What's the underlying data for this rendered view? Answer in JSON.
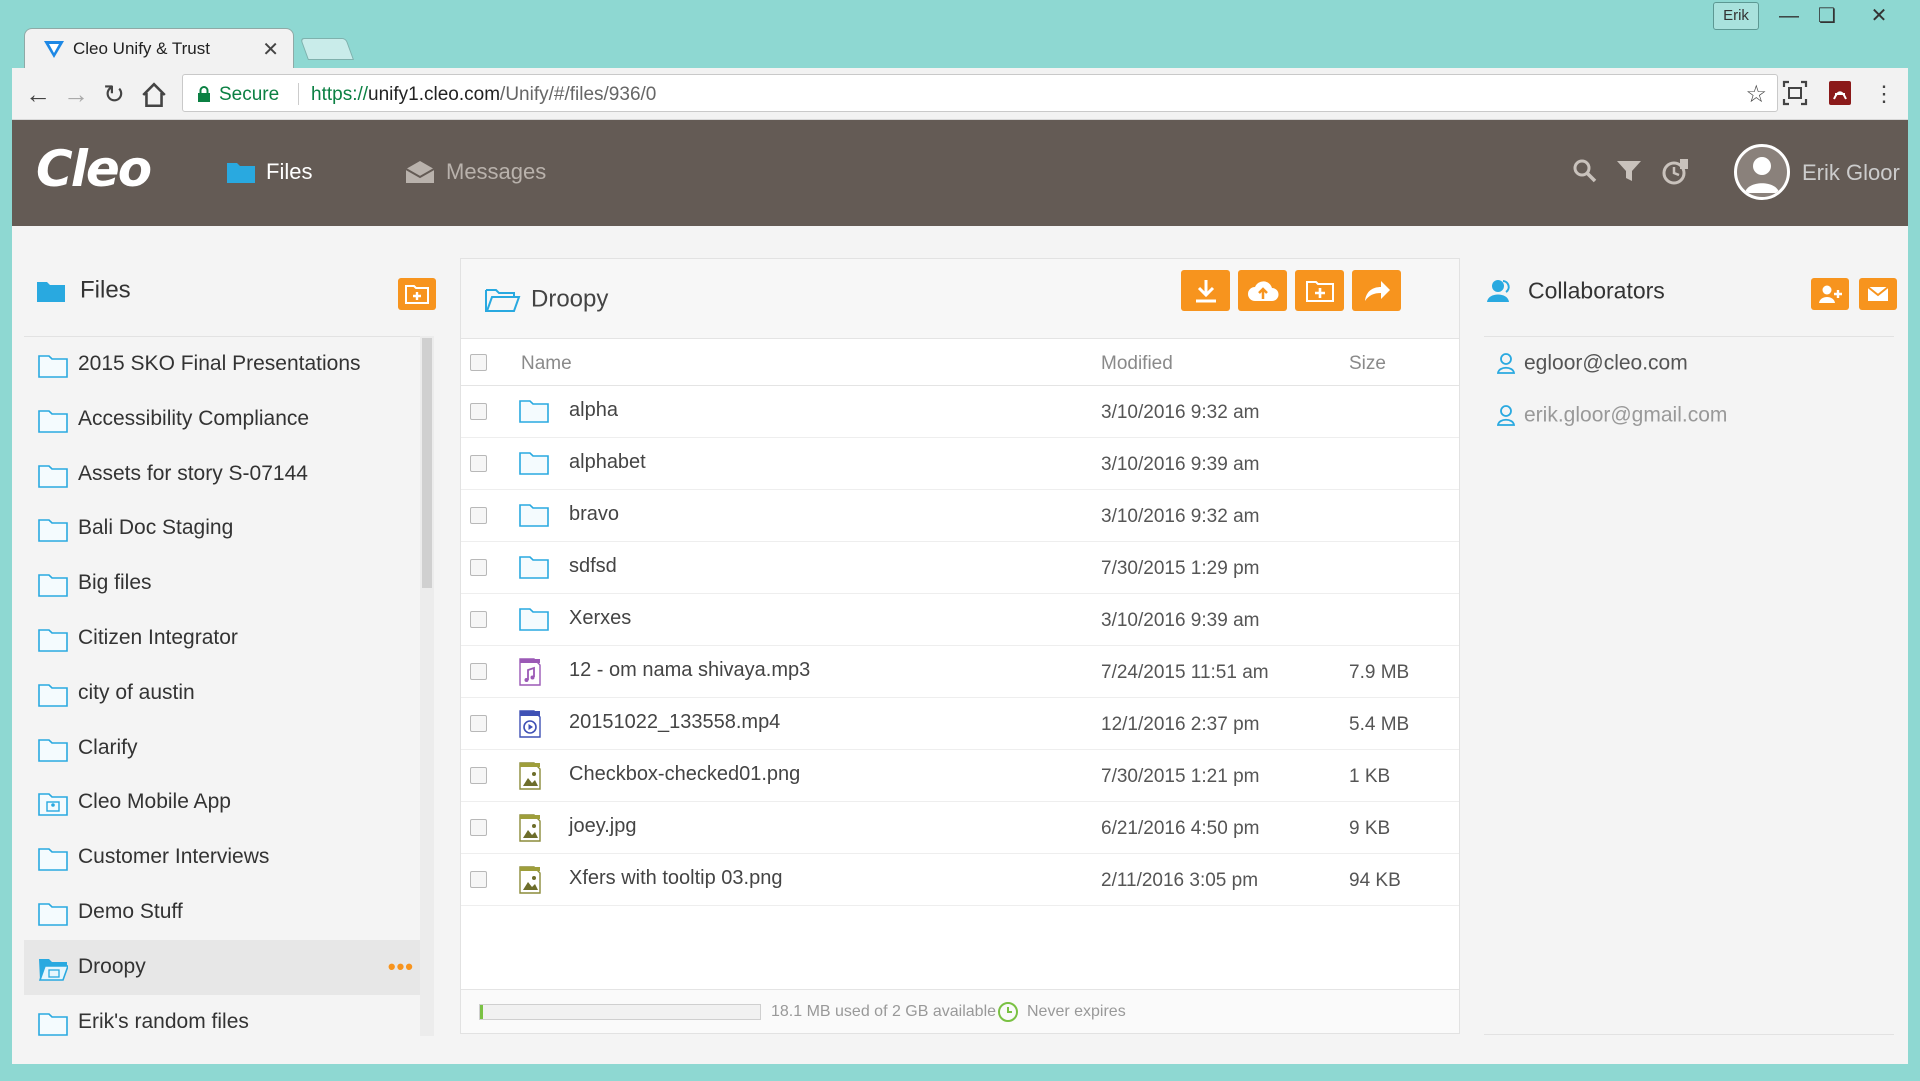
{
  "browser": {
    "profile_label": "Erik",
    "tab_title": "Cleo Unify & Trust",
    "secure_label": "Secure",
    "url_scheme": "https://",
    "url_host": "unify1.cleo.com",
    "url_path": "/Unify/#/files/936/0"
  },
  "header": {
    "logo": "Cleo",
    "nav": [
      {
        "label": "Files"
      },
      {
        "label": "Messages"
      }
    ],
    "user_name": "Erik Gloor"
  },
  "sidebar": {
    "title": "Files",
    "items": [
      {
        "label": "2015 SKO Final Presentations",
        "icon": "folder-icon"
      },
      {
        "label": "Accessibility Compliance",
        "icon": "folder-icon"
      },
      {
        "label": "Assets for story S-07144",
        "icon": "folder-icon"
      },
      {
        "label": "Bali Doc Staging",
        "icon": "folder-icon"
      },
      {
        "label": "Big files",
        "icon": "folder-icon"
      },
      {
        "label": "Citizen Integrator",
        "icon": "folder-icon"
      },
      {
        "label": "city of austin",
        "icon": "folder-icon"
      },
      {
        "label": "Clarify",
        "icon": "folder-icon"
      },
      {
        "label": "Cleo Mobile App",
        "icon": "shared-folder-icon"
      },
      {
        "label": "Customer Interviews",
        "icon": "folder-icon"
      },
      {
        "label": "Demo Stuff",
        "icon": "folder-icon"
      },
      {
        "label": "Droopy",
        "icon": "shared-folder-open-icon",
        "active": true
      },
      {
        "label": "Erik's random files",
        "icon": "folder-icon"
      }
    ],
    "more_label": "•••"
  },
  "folder": {
    "title": "Droopy",
    "columns": {
      "name": "Name",
      "modified": "Modified",
      "size": "Size"
    },
    "rows": [
      {
        "name": "alpha",
        "modified": "3/10/2016 9:32 am",
        "size": "",
        "icon": "folder-icon"
      },
      {
        "name": "alphabet",
        "modified": "3/10/2016 9:39 am",
        "size": "",
        "icon": "folder-icon"
      },
      {
        "name": "bravo",
        "modified": "3/10/2016 9:32 am",
        "size": "",
        "icon": "folder-icon"
      },
      {
        "name": "sdfsd",
        "modified": "7/30/2015 1:29 pm",
        "size": "",
        "icon": "folder-icon"
      },
      {
        "name": "Xerxes",
        "modified": "3/10/2016 9:39 am",
        "size": "",
        "icon": "folder-icon"
      },
      {
        "name": "12 - om nama shivaya.mp3",
        "modified": "7/24/2015 11:51 am",
        "size": "7.9 MB",
        "icon": "audio-file-icon"
      },
      {
        "name": "20151022_133558.mp4",
        "modified": "12/1/2016 2:37 pm",
        "size": "5.4 MB",
        "icon": "video-file-icon"
      },
      {
        "name": "Checkbox-checked01.png",
        "modified": "7/30/2015 1:21 pm",
        "size": "1 KB",
        "icon": "image-file-icon"
      },
      {
        "name": "joey.jpg",
        "modified": "6/21/2016 4:50 pm",
        "size": "9 KB",
        "icon": "image-file-icon"
      },
      {
        "name": "Xfers with tooltip 03.png",
        "modified": "2/11/2016 3:05 pm",
        "size": "94 KB",
        "icon": "image-file-icon"
      }
    ],
    "usage_text": "18.1 MB used of 2 GB available",
    "usage_fraction": 0.009,
    "expires_text": "Never expires"
  },
  "collaborators": {
    "title": "Collaborators",
    "people": [
      {
        "email": "egloor@cleo.com"
      },
      {
        "email": "erik.gloor@gmail.com"
      }
    ]
  },
  "colors": {
    "accent_orange": "#f7941e",
    "header_bg": "#645b55",
    "folder_blue": "#29a9e0",
    "frame_teal": "#8ed8d2"
  }
}
